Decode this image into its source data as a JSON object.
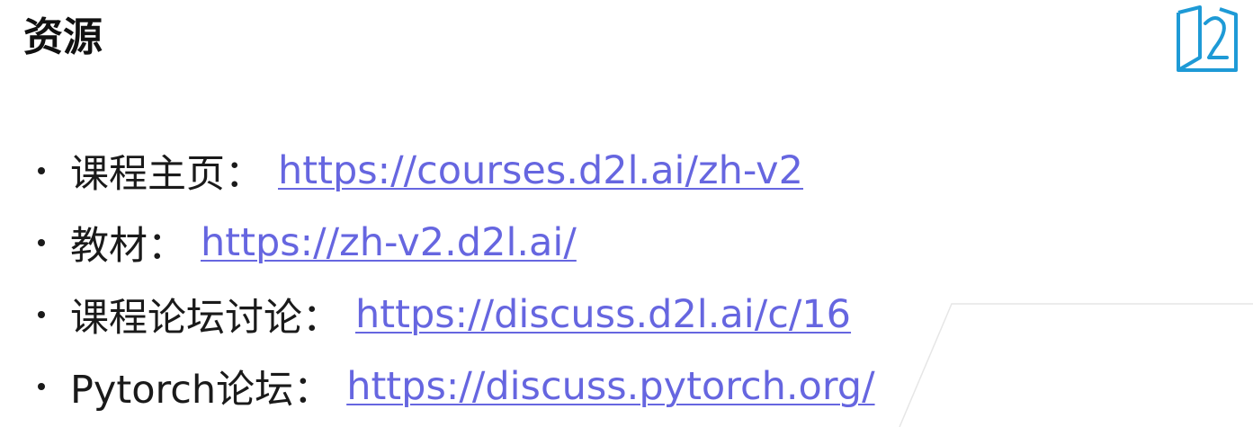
{
  "slide": {
    "title": "资源"
  },
  "items": [
    {
      "label": "课程主页：",
      "link": "https://courses.d2l.ai/zh-v2"
    },
    {
      "label": "教材：",
      "link": "https://zh-v2.d2l.ai/"
    },
    {
      "label": "课程论坛讨论：",
      "link": "https://discuss.d2l.ai/c/16"
    },
    {
      "label": "Pytorch论坛：",
      "link": "https://discuss.pytorch.org/"
    }
  ],
  "colors": {
    "link": "#6666e0",
    "logo": "#1e9ad6",
    "text": "#1a1a1a"
  },
  "icons": {
    "logo": "d2l-book-logo-icon"
  }
}
